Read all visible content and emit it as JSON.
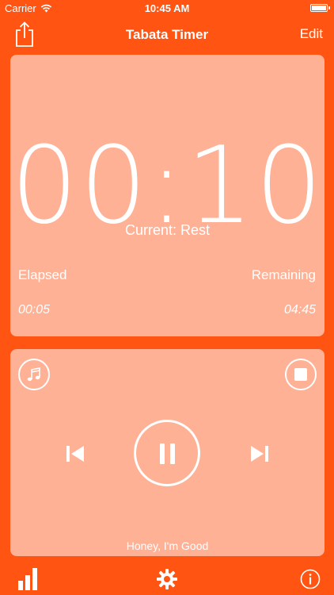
{
  "status_bar": {
    "carrier": "Carrier",
    "time": "10:45 AM"
  },
  "nav": {
    "title": "Tabata Timer",
    "edit_label": "Edit",
    "left_icon": "share-icon"
  },
  "timer": {
    "display": "00:10",
    "current_state": "Current: Rest",
    "elapsed_label": "Elapsed",
    "remaining_label": "Remaining",
    "elapsed_value": "00:05",
    "remaining_value": "04:45"
  },
  "player": {
    "song_title": "Honey, I'm Good",
    "icons": [
      "music-note-icon",
      "stop-icon",
      "previous-track-icon",
      "pause-icon",
      "next-track-icon"
    ]
  },
  "tab_bar": {
    "icons": [
      "stats-icon",
      "settings-icon",
      "info-icon"
    ]
  },
  "colors": {
    "background": "#FF5412",
    "card": "#FFB196",
    "foreground": "#FFFFFF"
  }
}
